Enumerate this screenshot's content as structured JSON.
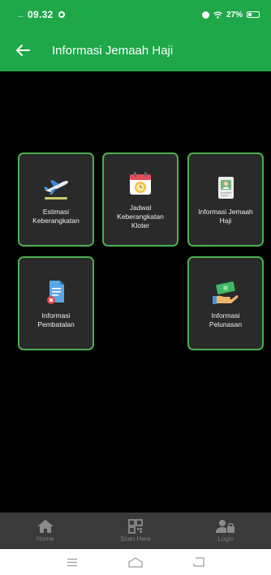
{
  "status_bar": {
    "signal": "....",
    "time": "09.32",
    "battery": "27%"
  },
  "app_bar": {
    "title": "Informasi Jemaah Haji"
  },
  "menu": {
    "estimasi": "Estimasi\nKeberangkatan",
    "jadwal": "Jadwal\nKeberangkatan\nKloter",
    "informasi_jemaah": "Informasi Jemaah\nHaji",
    "pembatalan": "Informasi\nPembatalan",
    "pelunasan": "Informasi\nPelunasan"
  },
  "bottom_nav": {
    "home": "Home",
    "scan": "Scan Here",
    "login": "Login"
  },
  "colors": {
    "primary": "#1ea84a",
    "tile_border": "#4caf50",
    "tile_bg": "#2a2a2a",
    "background": "#000000"
  }
}
